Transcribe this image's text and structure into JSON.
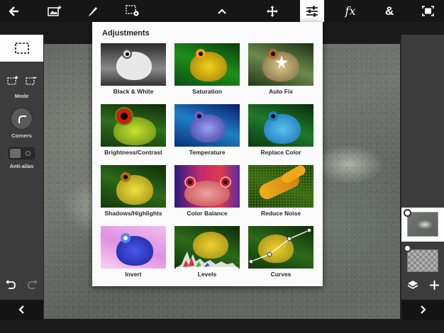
{
  "toolbar": {
    "icons": [
      "back-arrow-icon",
      "add-image-icon",
      "brush-icon",
      "selection-settings-icon",
      "chevron-up-icon",
      "move-icon",
      "adjustments-icon",
      "fx-icon",
      "ampersand-icon",
      "fit-screen-icon"
    ],
    "fx_label": "fx",
    "amp_label": "&",
    "active_tool": "adjustments"
  },
  "left_panel": {
    "mode_label": "Mode",
    "corners_label": "Corners",
    "antialias_label": "Anti-alias"
  },
  "adjustments": {
    "title": "Adjustments",
    "items": [
      {
        "label": "Black & White"
      },
      {
        "label": "Saturation"
      },
      {
        "label": "Auto Fix"
      },
      {
        "label": "Brightness/Contrast"
      },
      {
        "label": "Temperature"
      },
      {
        "label": "Replace Color"
      },
      {
        "label": "Shadows/Highlights"
      },
      {
        "label": "Color Balance"
      },
      {
        "label": "Reduce Noise"
      },
      {
        "label": "Invert"
      },
      {
        "label": "Levels"
      },
      {
        "label": "Curves"
      }
    ]
  },
  "colors": {
    "toolbar_bg": "#161616",
    "panel_bg": "#3c3c3c",
    "popup_bg": "#fbfbfb"
  }
}
